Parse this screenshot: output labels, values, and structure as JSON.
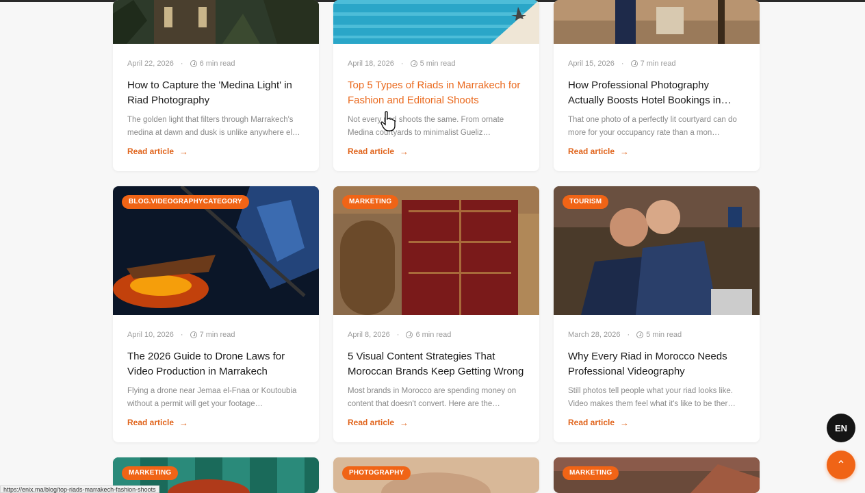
{
  "cards": [
    {
      "date": "April 22, 2026",
      "read_time": "6 min read",
      "title": "How to Capture the 'Medina Light' in Riad Photography",
      "excerpt": "The golden light that filters through Marrakech's medina at dawn and dusk is unlike anywhere el…",
      "cta": "Read article"
    },
    {
      "date": "April 18, 2026",
      "read_time": "5 min read",
      "title": "Top 5 Types of Riads in Marrakech for Fashion and Editorial Shoots",
      "excerpt": "Not every riad shoots the same. From ornate Medina courtyards to minimalist Gueliz…",
      "cta": "Read article"
    },
    {
      "date": "April 15, 2026",
      "read_time": "7 min read",
      "title": "How Professional Photography Actually Boosts Hotel Bookings in…",
      "excerpt": "That one photo of a perfectly lit courtyard can do more for your occupancy rate than a mon…",
      "cta": "Read article"
    },
    {
      "tag": "BLOG.VIDEOGRAPHYCATEGORY",
      "date": "April 10, 2026",
      "read_time": "7 min read",
      "title": "The 2026 Guide to Drone Laws for Video Production in Marrakech",
      "excerpt": "Flying a drone near Jemaa el-Fnaa or Koutoubia without a permit will get your footage…",
      "cta": "Read article"
    },
    {
      "tag": "MARKETING",
      "date": "April 8, 2026",
      "read_time": "6 min read",
      "title": "5 Visual Content Strategies That Moroccan Brands Keep Getting Wrong",
      "excerpt": "Most brands in Morocco are spending money on content that doesn't convert. Here are the…",
      "cta": "Read article"
    },
    {
      "tag": "TOURISM",
      "date": "March 28, 2026",
      "read_time": "5 min read",
      "title": "Why Every Riad in Morocco Needs Professional Videography",
      "excerpt": "Still photos tell people what your riad looks like. Video makes them feel what it's like to be ther…",
      "cta": "Read article"
    },
    {
      "tag": "MARKETING"
    },
    {
      "tag": "PHOTOGRAPHY"
    },
    {
      "tag": "MARKETING"
    }
  ],
  "lang_button": "EN",
  "status_url": "https://enix.ma/blog/top-riads-marrakech-fashion-shoots",
  "colors": {
    "accent": "#f06416",
    "dark": "#151515"
  }
}
